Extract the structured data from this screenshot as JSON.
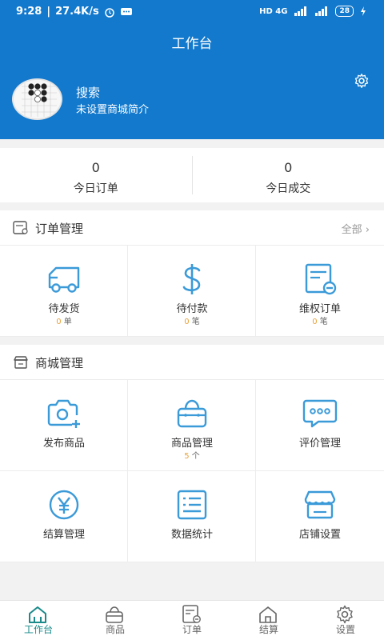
{
  "status_bar": {
    "time": "9:28",
    "speed": "27.4K/s",
    "network": "HD 4G",
    "battery": "28"
  },
  "header": {
    "title": "工作台",
    "store_name": "搜索",
    "store_desc": "未设置商城简介"
  },
  "stats": [
    {
      "value": "0",
      "label": "今日订单"
    },
    {
      "value": "0",
      "label": "今日成交"
    }
  ],
  "order_section": {
    "title": "订单管理",
    "more": "全部",
    "items": [
      {
        "label": "待发货",
        "count": "0",
        "unit": "单",
        "icon": "truck-icon"
      },
      {
        "label": "待付款",
        "count": "0",
        "unit": "笔",
        "icon": "dollar-icon"
      },
      {
        "label": "维权订单",
        "count": "0",
        "unit": "笔",
        "icon": "refund-doc-icon"
      }
    ]
  },
  "mall_section": {
    "title": "商城管理",
    "items": [
      {
        "label": "发布商品",
        "icon": "camera-add-icon"
      },
      {
        "label": "商品管理",
        "count": "5",
        "unit": "个",
        "icon": "basket-icon"
      },
      {
        "label": "评价管理",
        "icon": "comment-icon"
      },
      {
        "label": "结算管理",
        "icon": "yen-icon"
      },
      {
        "label": "数据统计",
        "icon": "stats-icon"
      },
      {
        "label": "店铺设置",
        "icon": "shop-icon"
      }
    ]
  },
  "tabbar": [
    {
      "label": "工作台",
      "active": true
    },
    {
      "label": "商品",
      "active": false
    },
    {
      "label": "订单",
      "active": false
    },
    {
      "label": "结算",
      "active": false
    },
    {
      "label": "设置",
      "active": false
    }
  ],
  "colors": {
    "brand": "#1279cd",
    "icon": "#3b9ad8",
    "count": "#e8a33a",
    "tab_active": "#1a8a8a"
  }
}
